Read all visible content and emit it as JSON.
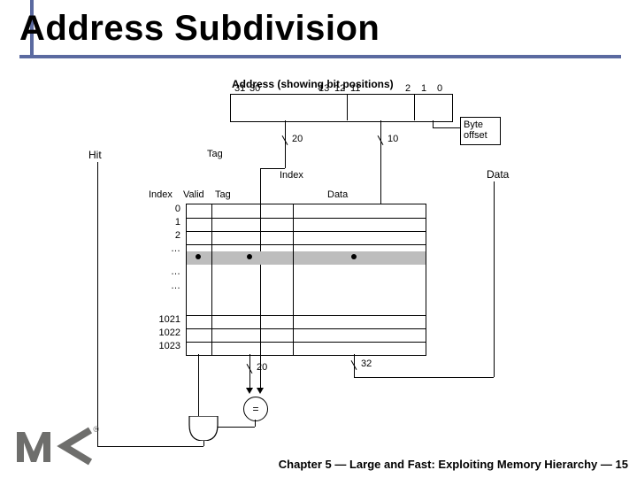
{
  "title": "Address Subdivision",
  "address": {
    "caption": "Address (showing bit positions)",
    "bits": {
      "msb_a": "31",
      "msb_b": "30",
      "ell_a": "· · ·",
      "mid_a": "13",
      "mid_b": "12",
      "mid_c": "11",
      "ell_b": "· · ·",
      "lo_a": "2",
      "lo_b": "1",
      "lo_c": "0"
    },
    "byte_offset_label": "Byte\noffset",
    "tag_label": "Tag",
    "index_label": "Index",
    "tag_width": "20",
    "index_width": "10"
  },
  "signals": {
    "hit": "Hit",
    "data": "Data"
  },
  "cache_table": {
    "headers": {
      "index": "Index",
      "valid": "Valid",
      "tag": "Tag",
      "data": "Data"
    },
    "index_rows": [
      "0",
      "1",
      "2",
      "…",
      "…",
      "…",
      "1021",
      "1022",
      "1023"
    ],
    "highlight_row": 3
  },
  "bus_widths": {
    "tag_out": "20",
    "data_out": "32"
  },
  "comparator_label": "=",
  "footer": {
    "chapter": "Chapter 5",
    "sep": "—",
    "title": "Large and Fast: Exploiting Memory Hierarchy",
    "page": "15"
  },
  "logo": {
    "text": "M<",
    "registered": "®"
  }
}
